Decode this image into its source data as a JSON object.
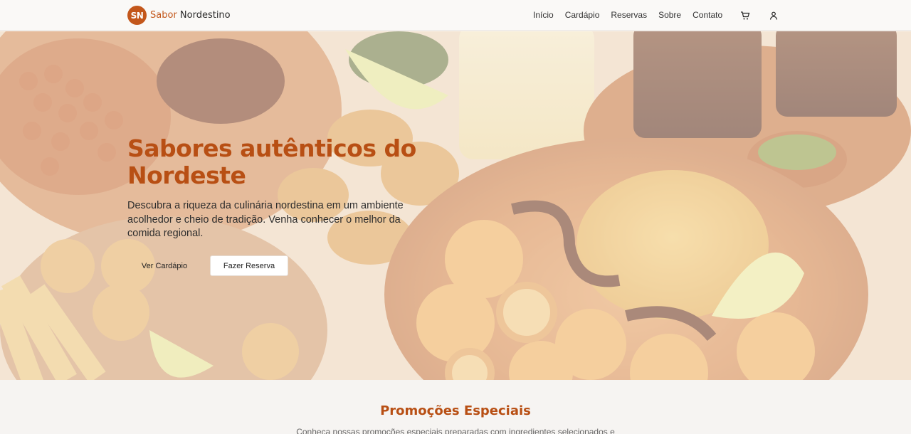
{
  "brand": {
    "badge": "SN",
    "name_first": "Sabor ",
    "name_second": "Nordestino",
    "accent_color": "#c3571b"
  },
  "nav": {
    "items": [
      "Início",
      "Cardápio",
      "Reservas",
      "Sobre",
      "Contato"
    ],
    "icons": [
      "cart-icon",
      "user-icon"
    ]
  },
  "hero": {
    "title_line1": "Sabores autênticos do",
    "title_line2": "Nordeste",
    "subtitle": "Descubra a riqueza da culinária nordestina em um ambiente acolhedor e cheio de tradição. Venha conhecer o melhor da comida regional.",
    "btn_menu": "Ver Cardápio",
    "btn_reserve": "Fazer Reserva"
  },
  "promo": {
    "title": "Promoções Especiais",
    "subtitle": "Conheça nossas promoções especiais preparadas com ingredientes selecionados e"
  },
  "colors": {
    "title": "#b84f14",
    "hero_bg": "#eadbc8",
    "page_bg": "#f7f5f3"
  }
}
